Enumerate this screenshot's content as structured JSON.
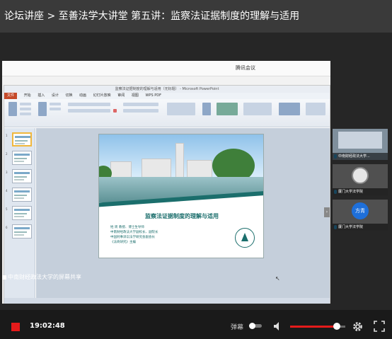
{
  "header": {
    "title": "论坛讲座 > 至善法学大讲堂 第五讲：监察法证据制度的理解与适用"
  },
  "meeting": {
    "title": "腾讯会议"
  },
  "ppt": {
    "window_title": "监察法证据制度的理解与适用（无标题） - Microsoft PowerPoint",
    "tabs": [
      "文件",
      "开始",
      "插入",
      "设计",
      "切换",
      "动画",
      "幻灯片放映",
      "审阅",
      "视图",
      "WPS PDF"
    ],
    "slide_numbers": [
      "1",
      "2",
      "3",
      "4",
      "5",
      "6"
    ],
    "slide": {
      "heading": "监察法证据制度的理解与适用",
      "lines": [
        "姓 周   教授、博士生导师",
        "中南财经政法大学副校长、副院长",
        "中国刑事诉讼法学研究会副会长",
        "《法商研究》主编"
      ]
    }
  },
  "participants": [
    {
      "label": "中南财经政法大学...",
      "avatar_icon": "school-badge-icon"
    },
    {
      "label": "厦门大学法学院",
      "avatar_icon": "school-seal-icon"
    },
    {
      "label": "厦门大学法学院",
      "avatar_text": "方青",
      "avatar_color": "#1e6fd9"
    }
  ],
  "share": {
    "label": "中南财经政法大学的屏幕共享"
  },
  "controls": {
    "time": "19:02:48",
    "danmu_label": "弹幕",
    "volume_level": 0.85,
    "accent_color": "#e51b1b"
  }
}
